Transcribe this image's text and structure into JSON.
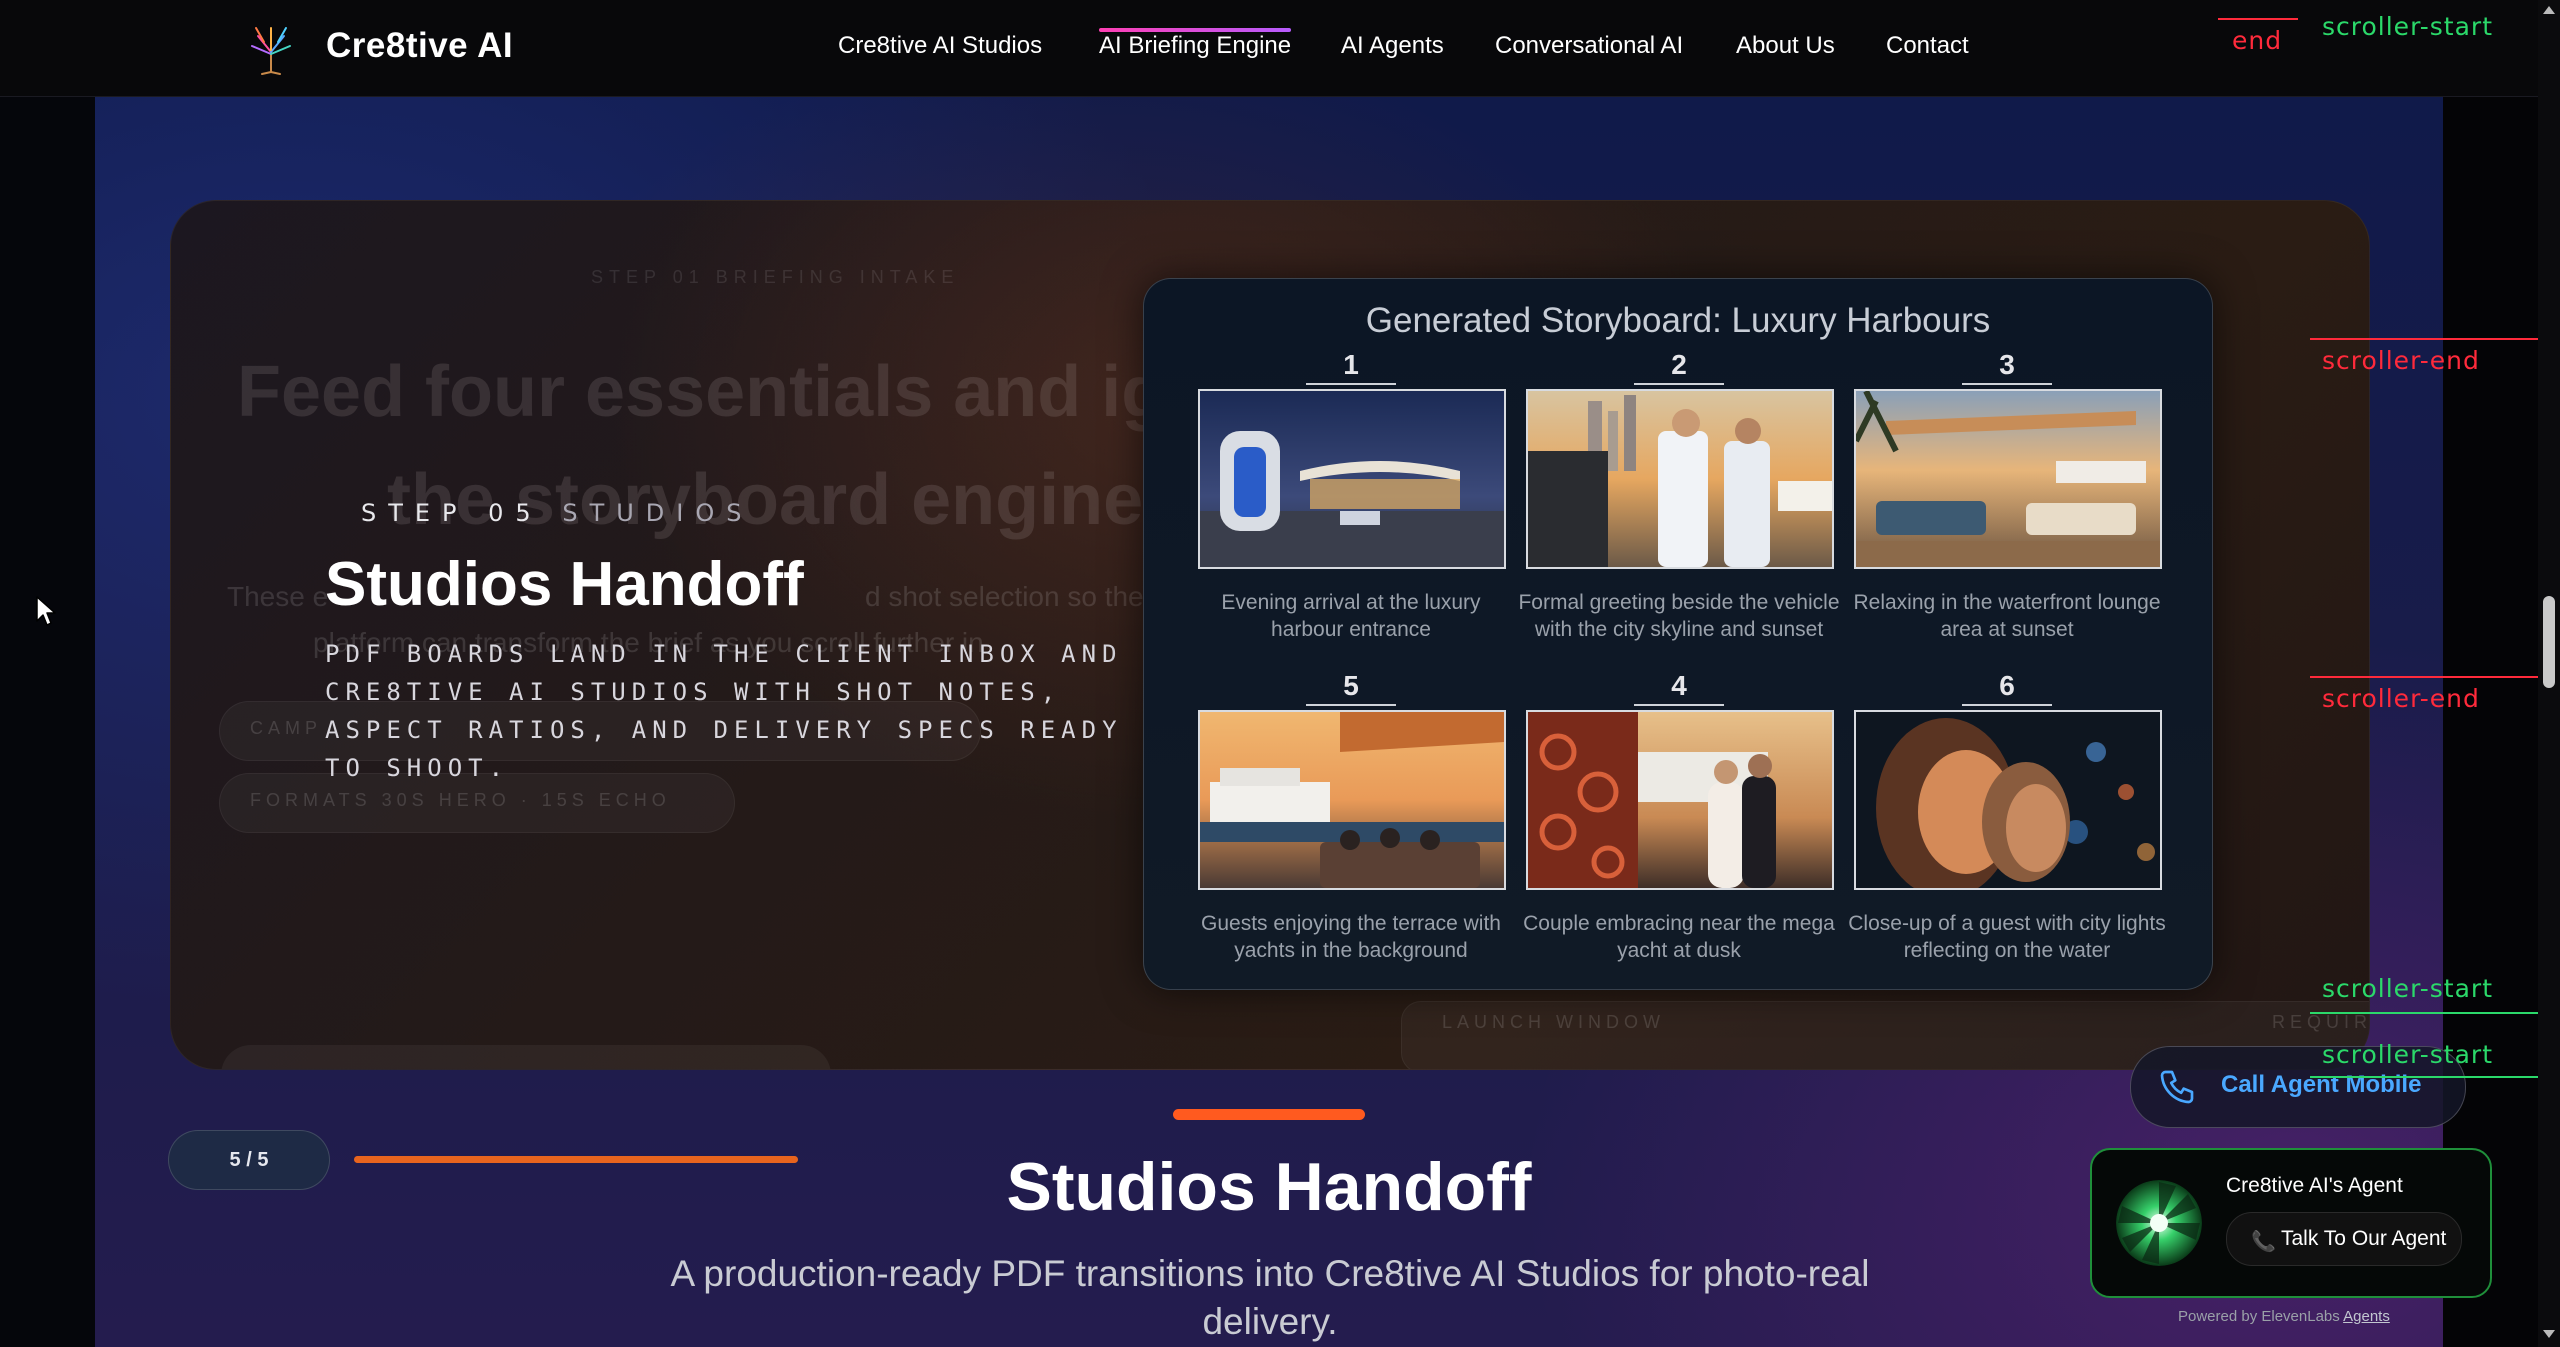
{
  "nav": {
    "brand": "Cre8tive AI",
    "items": [
      {
        "label": "Cre8tive AI Studios"
      },
      {
        "label": "AI Briefing Engine"
      },
      {
        "label": "AI Agents"
      },
      {
        "label": "Conversational AI"
      },
      {
        "label": "About Us"
      },
      {
        "label": "Contact"
      }
    ]
  },
  "debug_markers": {
    "end_top": "end",
    "start_top": "scroller-start",
    "end_1": "scroller-end",
    "end_2": "scroller-end",
    "start_2": "scroller-start",
    "start_3": "scroller-start",
    "colors": {
      "end": "#ff2a3b",
      "start": "#2bd96a"
    }
  },
  "ghost": {
    "kicker": "STEP 01 BRIEFING INTAKE",
    "title_line1": "Feed four essentials and ig",
    "title_line2": "the storyboard engine",
    "body_line1": "These e",
    "body_line1b": "d shot selection so the",
    "body_line2": "platform can transform the brief as you scroll further in",
    "pill1": "CAMP",
    "pill2": "FORMATS  30S HERO · 15S ECHO",
    "launch": "LAUNCH WINDOW",
    "required": "REQUIRED"
  },
  "step": {
    "label_strong": "STEP 05",
    "label_dim": "STUDIOS",
    "title": "Studios Handoff",
    "description": "PDF boards land in the client inbox and Cre8tive AI Studios with shot notes, aspect ratios, and delivery specs ready to shoot."
  },
  "storyboard": {
    "title": "Generated Storyboard: Luxury Harbours",
    "frames": [
      {
        "number": "1",
        "caption": "Evening arrival at the luxury harbour entrance"
      },
      {
        "number": "2",
        "caption": "Formal greeting beside the vehicle with the city skyline and sunset"
      },
      {
        "number": "3",
        "caption": "Relaxing in the waterfront lounge area at sunset"
      },
      {
        "number": "5",
        "caption": "Guests enjoying the terrace with yachts in the background"
      },
      {
        "number": "4",
        "caption": "Couple embracing near the mega yacht at dusk"
      },
      {
        "number": "6",
        "caption": "Close-up of a guest with city lights reflecting on the water"
      }
    ]
  },
  "progress": {
    "counter": "5 / 5",
    "fraction": 1.0
  },
  "section": {
    "title": "Studios Handoff",
    "subtitle": "A production-ready PDF transitions into Cre8tive AI Studios for photo-real delivery."
  },
  "call_widget": {
    "button_label": "Call Agent Mobile",
    "agent_name": "Cre8tive AI's Agent",
    "talk_label": "Talk To Our Agent",
    "powered_prefix": "Powered by ElevenLabs",
    "powered_link": "Agents"
  },
  "icons": {
    "logo": "tree-logo-icon",
    "phone": "phone-icon",
    "orb": "agent-orb-icon"
  },
  "colors": {
    "accent_orange": "#ff5a1f",
    "call_blue": "#4aa8ff",
    "agent_green": "#1f8f3a"
  }
}
